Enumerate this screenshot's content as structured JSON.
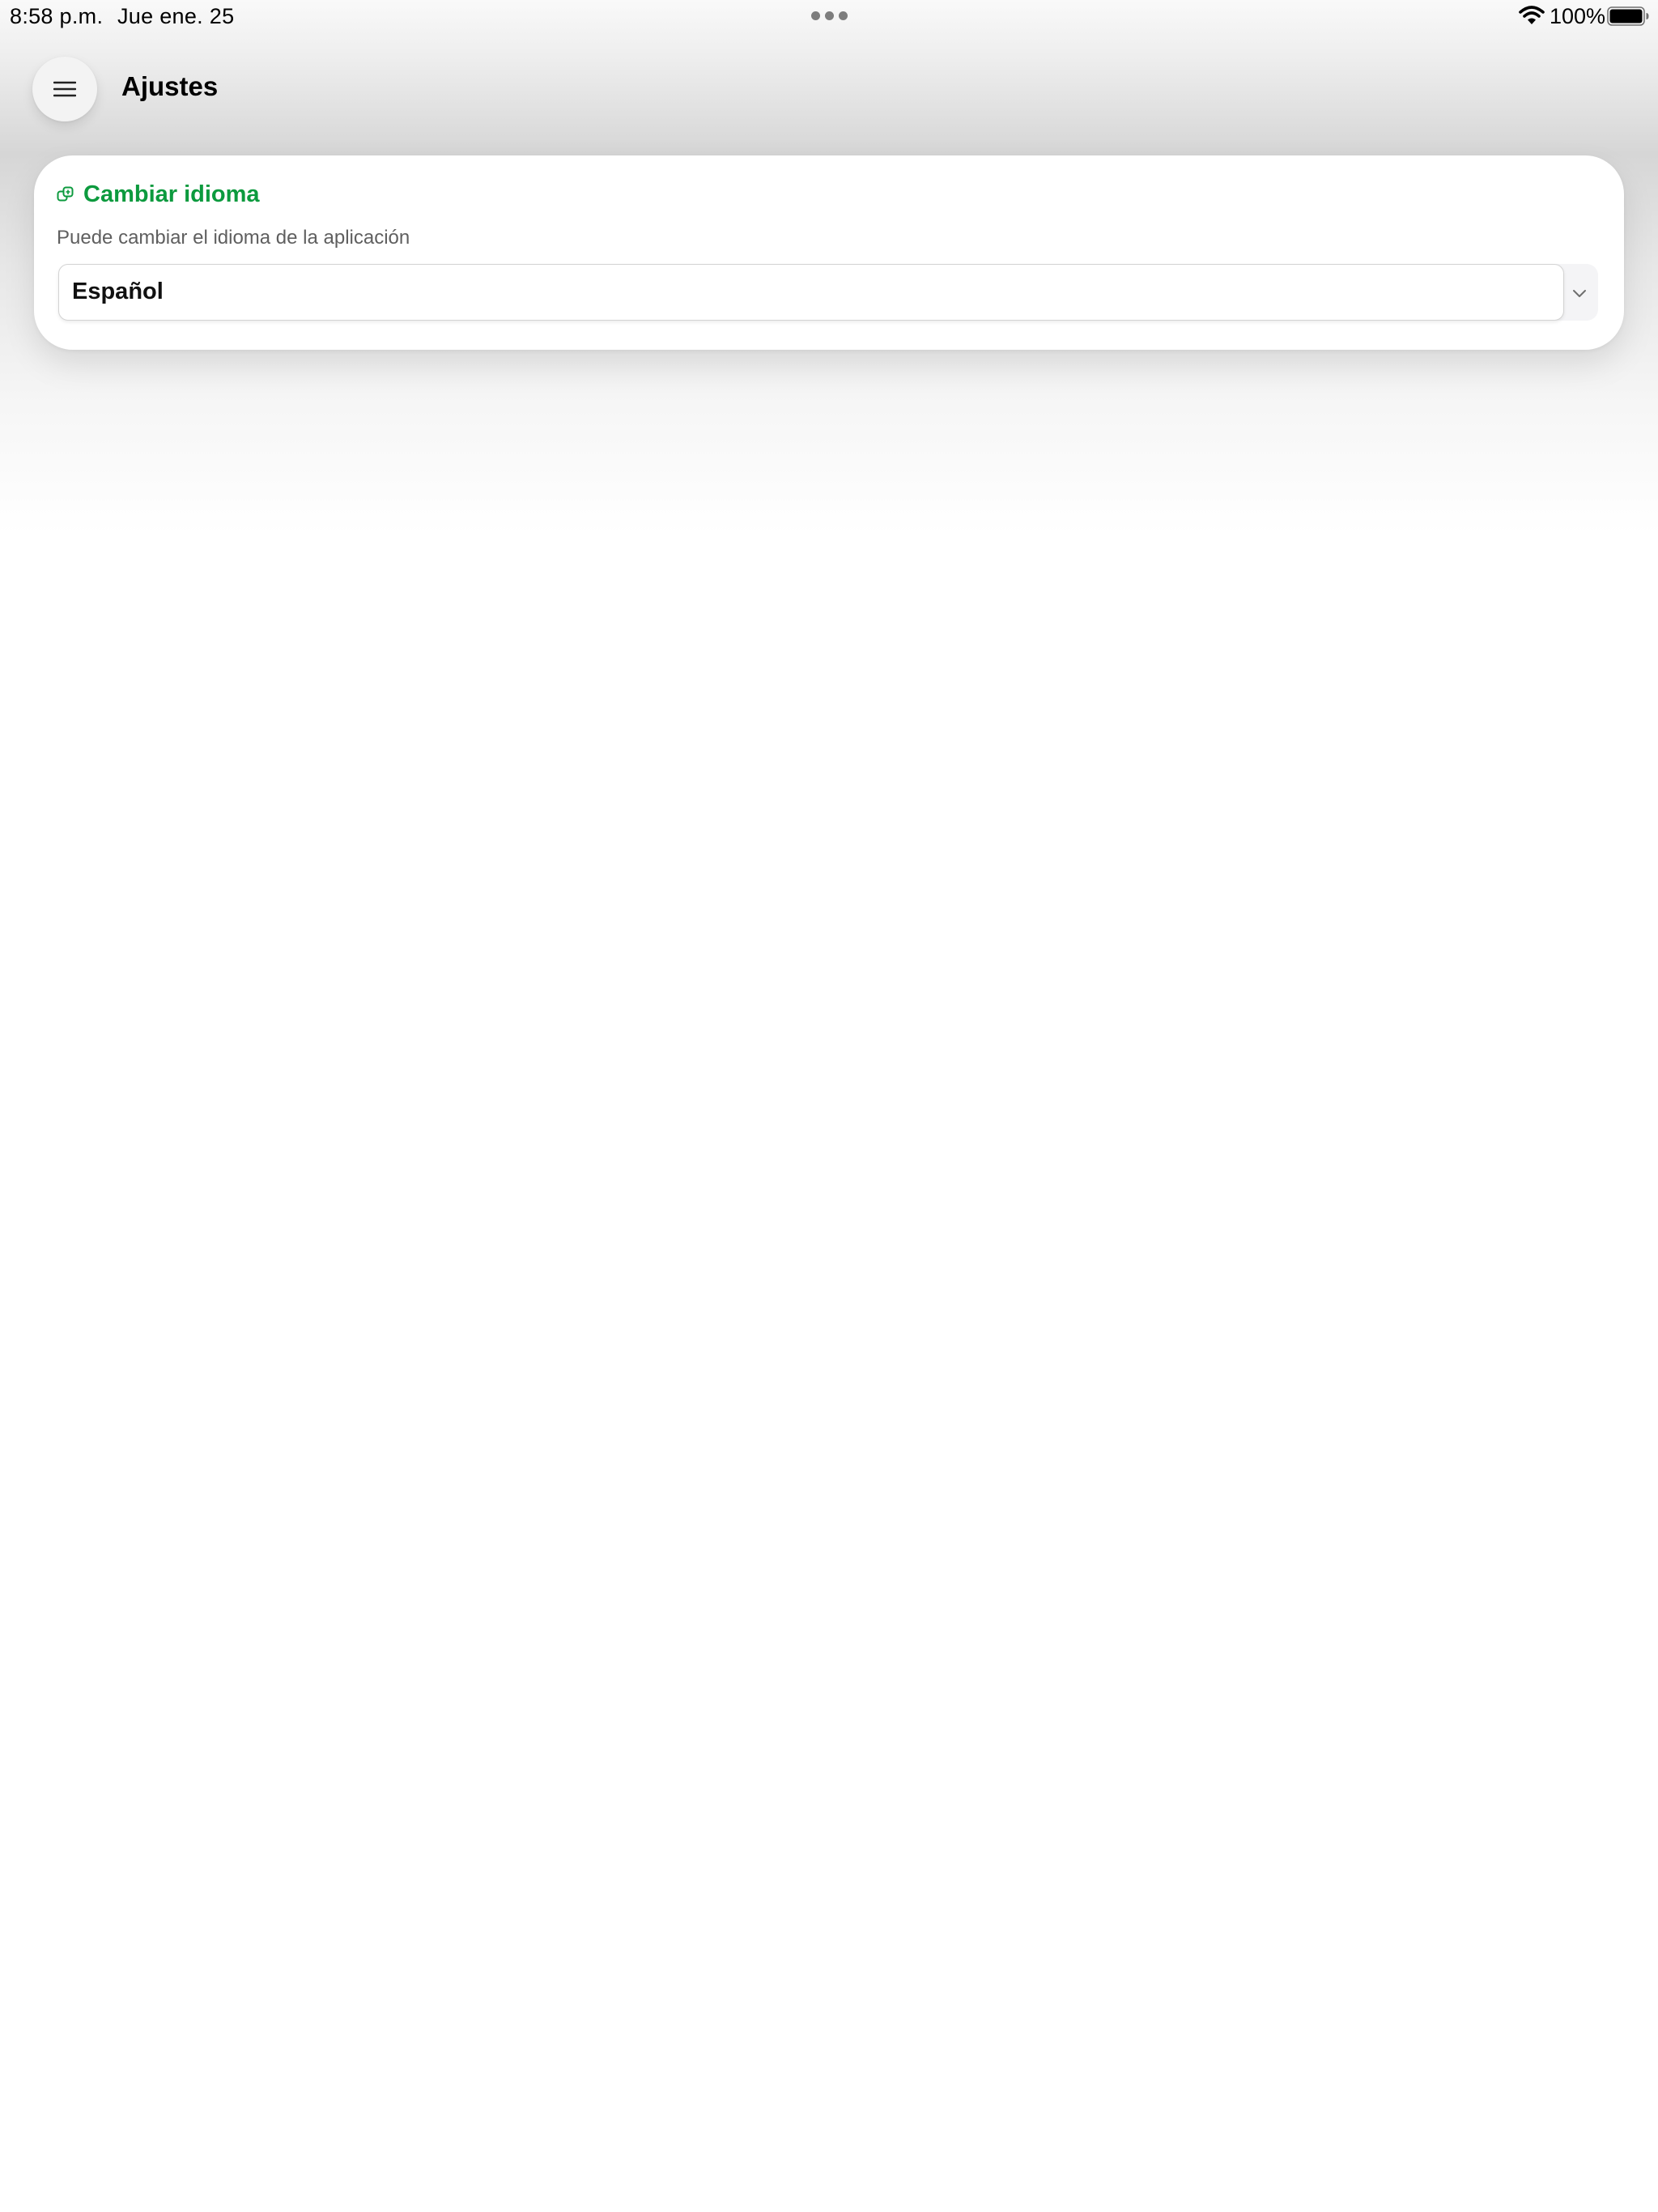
{
  "status_bar": {
    "time": "8:58 p.m.",
    "date": "Jue ene. 25",
    "battery_percent": "100%",
    "icons": [
      "wifi-icon",
      "battery-icon"
    ]
  },
  "header": {
    "title": "Ajustes",
    "menu_icon": "menu-icon"
  },
  "language_card": {
    "icon": "language-icon",
    "title": "Cambiar idioma",
    "subtitle": "Puede cambiar el idioma de la aplicación",
    "selected_language": "Español"
  },
  "colors": {
    "accent": "#0c9a3e",
    "subtitle": "#5f5f5f",
    "background": "#ffffff"
  }
}
